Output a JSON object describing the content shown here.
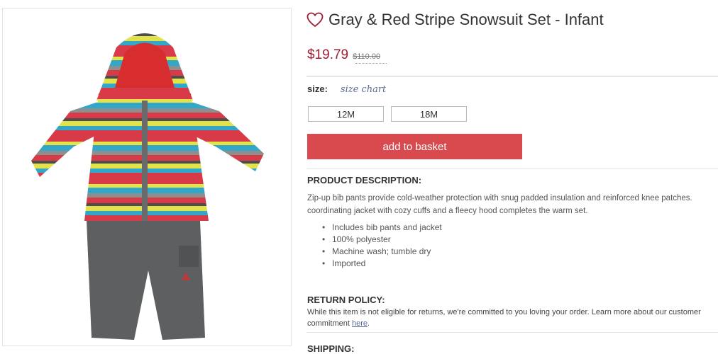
{
  "product": {
    "title": "Gray & Red Stripe Snowsuit Set - Infant",
    "price": "$19.79",
    "original_price": "$110.00",
    "image_alt": "Gray & Red Stripe Snowsuit Set"
  },
  "size": {
    "label": "size:",
    "chart_link": "size chart",
    "options": [
      "12M",
      "18M"
    ]
  },
  "cart": {
    "add_label": "add to basket"
  },
  "description": {
    "heading": "PRODUCT DESCRIPTION:",
    "line1": "Zip-up bib pants provide cold-weather protection with snug padded insulation and reinforced knee patches.",
    "line2": "coordinating jacket with cozy cuffs and a fleecy hood completes the warm set.",
    "bullets": [
      "Includes bib pants and jacket",
      "100% polyester",
      "Machine wash; tumble dry",
      "Imported"
    ]
  },
  "return_policy": {
    "heading": "RETURN POLICY:",
    "text_before_link": "While this item is not eligible for returns, we're committed to you loving your order. Learn more about our customer commitment ",
    "link": "here",
    "text_after_link": "."
  },
  "shipping": {
    "heading": "SHIPPING:"
  },
  "colors": {
    "price": "#9e1b32",
    "button": "#d94a4f",
    "link": "#5a6b94"
  },
  "icons": {
    "favorite": "heart-outline-icon"
  }
}
